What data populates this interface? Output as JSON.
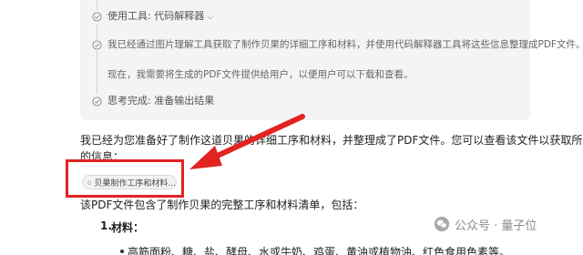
{
  "thinking": {
    "tool_step": {
      "label": "使用工具: 代码解释器",
      "chevron": "chevron-down-icon"
    },
    "analysis_step": {
      "line1": "我已经通过图片理解工具获取了制作贝果的详细工序和材料，并使用代码解释器工具将这些信息整理成PDF文件。",
      "line2": "现在，我需要将生成的PDF文件提供给用户，以便用户可以下载和查看。"
    },
    "done_step": {
      "label": "思考完成: 准备输出结果"
    }
  },
  "answer": {
    "intro_line1": "我已经为您准备好了制作这道贝果的详细工序和材料，并整理成了PDF文件。您可以查看该文件以获取所有必要",
    "intro_line2": "的信息：",
    "file_chip": {
      "label": "贝果制作工序和材料...",
      "icon": "file-icon"
    },
    "description": "该PDF文件包含了制作贝果的完整工序和材料清单，包括：",
    "list": {
      "number": "1.",
      "heading": "材料：",
      "sub_item": "高筋面粉、糖、盐、酵母、水或牛奶、鸡蛋、黄油或植物油、红色食用色素等。"
    }
  },
  "annotation": {
    "color": "#e32222"
  },
  "watermark": {
    "text": "公众号 · 量子位",
    "icon": "wechat-icon"
  }
}
